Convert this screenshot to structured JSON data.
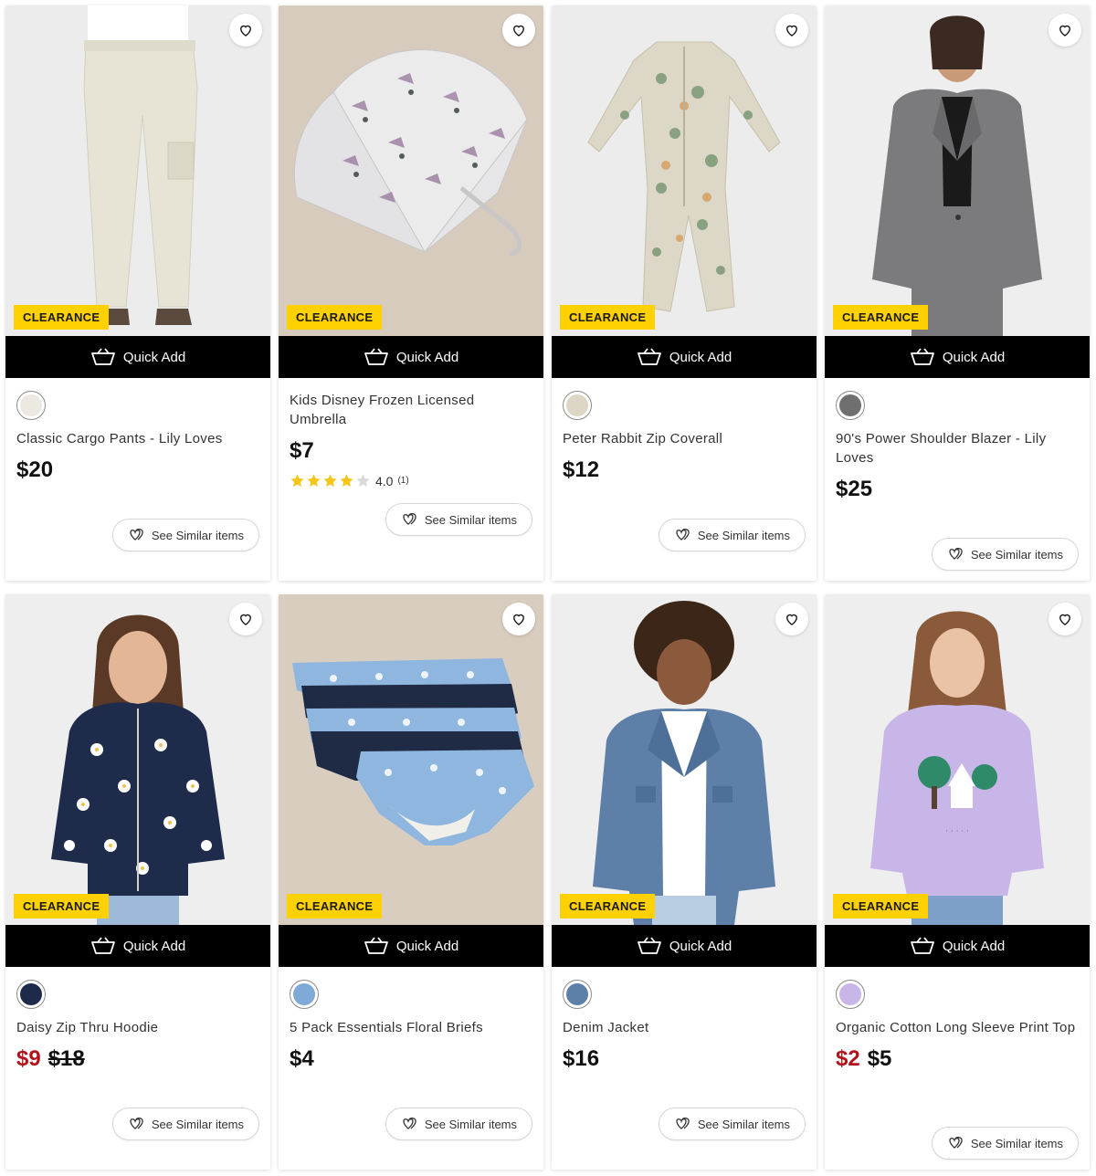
{
  "labels": {
    "clearance": "CLEARANCE",
    "quick_add": "Quick Add",
    "see_similar": "See Similar items"
  },
  "colors": {
    "badge_yellow": "#ffd100",
    "quick_add_bg": "#000000",
    "sale_red": "#b3121a",
    "star_gold": "#f5c518"
  },
  "icons": {
    "wishlist": "heart-outline-icon",
    "quick_add": "basket-icon",
    "similar": "similar-items-icon",
    "rating": "star-icon"
  },
  "products": [
    {
      "title": "Classic Cargo Pants - Lily Loves",
      "price": "$20",
      "was_price": "",
      "swatch_color": "#eceae0"
    },
    {
      "title": "Kids Disney Frozen Licensed Umbrella",
      "price": "$7",
      "was_price": "",
      "rating": "4.0",
      "rating_count": "(1)",
      "rating_value": 4
    },
    {
      "title": "Peter Rabbit Zip Coverall",
      "price": "$12",
      "was_price": "",
      "swatch_color": "#dcd6c4"
    },
    {
      "title": "90's Power Shoulder Blazer - Lily Loves",
      "price": "$25",
      "was_price": "",
      "swatch_color": "#6f6f6f"
    },
    {
      "title": "Daisy Zip Thru Hoodie",
      "price": "$9",
      "was_price": "$18",
      "swatch_color": "#1e2a4a"
    },
    {
      "title": "5 Pack Essentials Floral Briefs",
      "price": "$4",
      "was_price": "",
      "swatch_color": "#7fa9d6"
    },
    {
      "title": "Denim Jacket",
      "price": "$16",
      "was_price": "",
      "swatch_color": "#5d7fa8"
    },
    {
      "title": "Organic Cotton Long Sleeve Print Top",
      "price": "$2",
      "was_price": "$5",
      "swatch_color": "#c9b6e8"
    }
  ]
}
